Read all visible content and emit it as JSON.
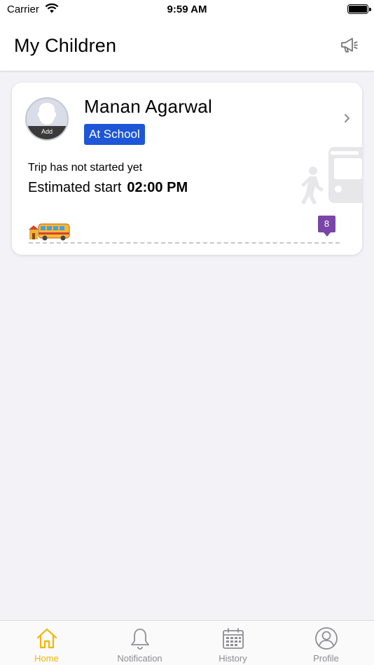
{
  "status_bar": {
    "carrier": "Carrier",
    "time": "9:59 AM"
  },
  "header": {
    "title": "My Children",
    "action_icon": "megaphone-icon"
  },
  "child_card": {
    "name": "Manan Agarwal",
    "avatar_label": "Add",
    "status_badge": "At School",
    "status_color": "#1e56d8",
    "trip_message": "Trip has not started yet",
    "estimated_label": "Estimated start",
    "estimated_time": "02:00 PM",
    "stop_marker": "8",
    "stop_marker_color": "#7b45a8"
  },
  "tab_bar": {
    "active_color": "#f2b600",
    "inactive_color": "#8e8e93",
    "tabs": [
      {
        "label": "Home",
        "icon": "home-icon",
        "active": true
      },
      {
        "label": "Notification",
        "icon": "bell-icon",
        "active": false
      },
      {
        "label": "History",
        "icon": "calendar-icon",
        "active": false
      },
      {
        "label": "Profile",
        "icon": "user-circle-icon",
        "active": false
      }
    ]
  }
}
